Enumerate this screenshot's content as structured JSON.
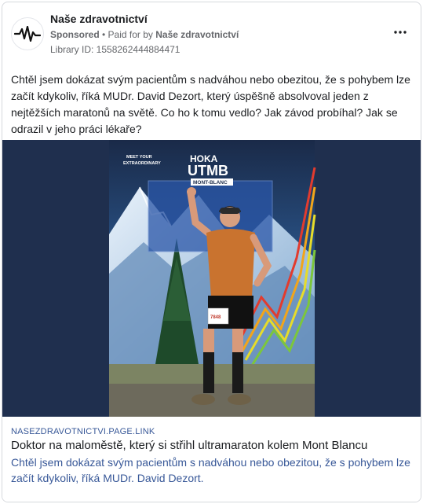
{
  "ad": {
    "page_name": "Naše zdravotnictví",
    "sponsored_label": "Sponsored",
    "paid_for_prefix": " • Paid for by ",
    "payer": "Naše zdravotnictví",
    "library_id": "Library ID: 1558262444884471",
    "more_icon": "more-horizontal-icon",
    "avatar_icon": "heartbeat-icon",
    "body_text": "Chtěl jsem dokázat svým pacientům s nadváhou nebo obezitou, že s pohybem lze začít kdykoliv, říká MUDr. David Dezort, který úspěšně absolvoval jeden z nejtěžších maratonů na světě. Co ho k tomu vedlo? Jak závod probíhal? Jak se odrazil v jeho práci lékaře?"
  },
  "image": {
    "banner_line1": "MEET YOUR",
    "banner_line2": "EXTRAORDINARY",
    "brand": "HOKA",
    "event": "UTMB",
    "sub_event": "MONT-BLANC",
    "bib_number": "7848"
  },
  "link": {
    "domain": "NASEZDRAVOTNICTVI.PAGE.LINK",
    "title": "Doktor na maloměstě, který si střihl ultramaraton kolem Mont Blancu",
    "description": "Chtěl jsem dokázat svým pacientům s nadváhou nebo obezitou, že s pohybem lze začít kdykoliv, říká MUDr. David Dezort."
  },
  "colors": {
    "link_blue": "#385898",
    "meta_gray": "#65676b",
    "image_bg": "#1f2f4e"
  }
}
